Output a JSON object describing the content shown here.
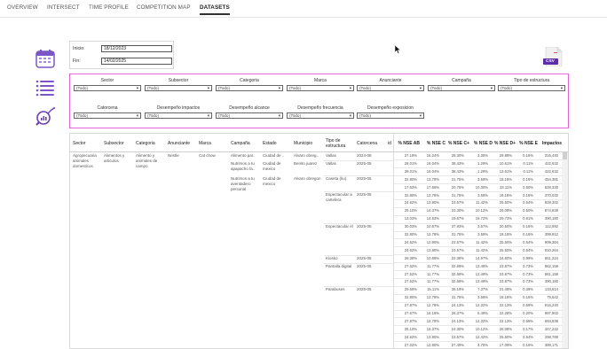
{
  "nav": {
    "tabs": [
      {
        "label": "OVERVIEW"
      },
      {
        "label": "INTERSECT"
      },
      {
        "label": "TIME PROFILE"
      },
      {
        "label": "COMPETITION MAP"
      },
      {
        "label": "DATASETS"
      }
    ],
    "active": "DATASETS"
  },
  "dates": {
    "inicio_label": "Inicio:",
    "inicio_value": "18/12/2023",
    "fin_label": "Fin:",
    "fin_value": "14/02/2025"
  },
  "csv": {
    "label": "CSV"
  },
  "filters": {
    "row1": [
      {
        "label": "Sector",
        "value": "(Todo)"
      },
      {
        "label": "Subsector",
        "value": "(Todo)"
      },
      {
        "label": "Categoria",
        "value": "(Todo)"
      },
      {
        "label": "Marca",
        "value": "(Todo)"
      },
      {
        "label": "Anunciante",
        "value": "(Todo)"
      },
      {
        "label": "Campaña",
        "value": "(Todo)"
      },
      {
        "label": "Tipo de estructura",
        "value": "(Todo)"
      }
    ],
    "row2": [
      {
        "label": "Catorcena",
        "value": "(Todo)"
      },
      {
        "label": "Desempeño impactos",
        "value": "(Todo)"
      },
      {
        "label": "Desempeño alcance",
        "value": "(Todo)"
      },
      {
        "label": "Desempeño frecuencia",
        "value": "(Todo)"
      },
      {
        "label": "Desempeño exposicion",
        "value": "(Todo)"
      }
    ]
  },
  "table": {
    "headers": [
      "Sector",
      "Subsector",
      "Categoria",
      "Anunciante",
      "Marca",
      "Campaña",
      "Estado",
      "Municipio",
      "Tipo de estructura",
      "Catorcena",
      "id",
      "% NSE AB",
      "% NSE C",
      "% NSE C+",
      "% NSE D",
      "% NSE D+",
      "% NSE E",
      "Impactos"
    ],
    "sector": "Agropecuaria animales domesticos",
    "subsector": "Alimentos y articulos",
    "categoria": "Alimento y animales de campo",
    "anunciante": "Nestle",
    "marca": "Cat chow",
    "campanas": [
      "Alimento par..",
      "Nutrimos a tu apapacho fa..",
      "Nutrimos a tu aventadero personal"
    ],
    "estados": [
      "Ciudad de ..",
      "Ciudad de mexico",
      "Ciudad de mexico"
    ],
    "municipios": [
      "Alvaro obreg..",
      "Benito juarez",
      "Alvaro obregon"
    ],
    "tipos": [
      "Vallas",
      "Vallas",
      "Caseta (ku)",
      "Espectacular a cartelera",
      "Espectacular el",
      "Kiosko",
      "Pantalla digital",
      "Parabuses"
    ],
    "catorcenas": [
      "2024-08",
      "2025-05",
      "2025-05",
      "2025-05",
      "2025-05",
      "2025-05",
      "2025-05",
      "2025-05"
    ],
    "rows": [
      [
        "27.19%",
        "16.24%",
        "28.30%",
        "3.35%",
        "29.89%",
        "0.16%",
        "316,440"
      ],
      [
        "28.01%",
        "16.04%",
        "38.43%",
        "1.29%",
        "10.61%",
        "0.11%",
        "422,632"
      ],
      [
        "28.01%",
        "16.04%",
        "38.43%",
        "1.29%",
        "13.61%",
        "0.11%",
        "422,632"
      ],
      [
        "32.80%",
        "13.78%",
        "31.75%",
        "3.59%",
        "18.18%",
        "0.16%",
        "454,381"
      ],
      [
        "17.63%",
        "17.66%",
        "20.75%",
        "10.30%",
        "33.11%",
        "0.50%",
        "528,330"
      ],
      [
        "32.80%",
        "13.78%",
        "31.75%",
        "3.59%",
        "18.18%",
        "0.16%",
        "370,032"
      ],
      [
        "24.62%",
        "13.90%",
        "23.57%",
        "11.42%",
        "25.50%",
        "0.54%",
        "928,302"
      ],
      [
        "25.10%",
        "14.37%",
        "23.30%",
        "10.12%",
        "26.08%",
        "0.50%",
        "874,638"
      ],
      [
        "13.03%",
        "14.63%",
        "19.67%",
        "16.72%",
        "29.73%",
        "0.91%",
        "390,180"
      ],
      [
        "30.03%",
        "10.67%",
        "37.93%",
        "3.57%",
        "20.50%",
        "0.16%",
        "112,892"
      ],
      [
        "32.80%",
        "13.78%",
        "31.75%",
        "3.59%",
        "18.18%",
        "0.16%",
        "399,912"
      ],
      [
        "24.62%",
        "13.90%",
        "23.57%",
        "11.42%",
        "25.50%",
        "0.54%",
        "909,304"
      ],
      [
        "24.62%",
        "13.90%",
        "23.57%",
        "11.42%",
        "25.50%",
        "0.54%",
        "810,264"
      ],
      [
        "26.38%",
        "10.69%",
        "22.38%",
        "14.97%",
        "24.60%",
        "0.99%",
        "651,224"
      ],
      [
        "27.52%",
        "11.77%",
        "32.69%",
        "13.49%",
        "23.87%",
        "0.73%",
        "862,158"
      ],
      [
        "27.52%",
        "11.77%",
        "32.69%",
        "13.49%",
        "23.87%",
        "0.73%",
        "861,158"
      ],
      [
        "27.52%",
        "11.77%",
        "32.69%",
        "13.49%",
        "23.87%",
        "0.73%",
        "390,180"
      ],
      [
        "29.59%",
        "15.11%",
        "36.19%",
        "7.37%",
        "21.49%",
        "0.39%",
        "133,614"
      ],
      [
        "32.80%",
        "13.78%",
        "31.75%",
        "3.59%",
        "18.18%",
        "0.16%",
        "79,542"
      ],
      [
        "27.87%",
        "12.78%",
        "24.13%",
        "12.32%",
        "22.13%",
        "0.59%",
        "916,240"
      ],
      [
        "27.67%",
        "16.18%",
        "26.37%",
        "5.49%",
        "22.28%",
        "0.20%",
        "987,902"
      ],
      [
        "27.87%",
        "12.78%",
        "24.13%",
        "12.32%",
        "22.13%",
        "0.59%",
        "694,938"
      ],
      [
        "25.10%",
        "15.37%",
        "24.30%",
        "10.12%",
        "26.08%",
        "0.17%",
        "347,242"
      ],
      [
        "24.62%",
        "13.90%",
        "23.57%",
        "12.42%",
        "25.50%",
        "0.54%",
        "298,788"
      ],
      [
        "27.02%",
        "13.90%",
        "27.49%",
        "4.75%",
        "17.09%",
        "0.16%",
        "389,171"
      ]
    ]
  },
  "colors": {
    "accent_purple": "#6a3fb5",
    "filter_border": "#e466d8",
    "csv_badge": "#5b2ea6"
  }
}
